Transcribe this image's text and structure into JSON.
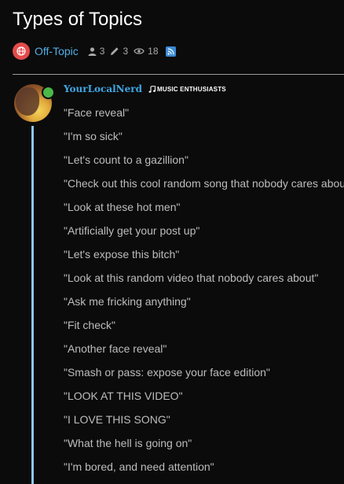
{
  "topic": {
    "title": "Types of Topics",
    "category": "Off-Topic",
    "stats": {
      "users": "3",
      "edits": "3",
      "views": "18"
    }
  },
  "post": {
    "username": "YourLocalNerd",
    "flair": "MUSIC ENTHUSIASTS",
    "items": [
      "\"Face reveal\"",
      "\"I'm so sick\"",
      "\"Let's count to a gazillion\"",
      "\"Check out this cool random song that nobody cares about\"",
      "\"Look at these hot men\"",
      "\"Artificially get your post up\"",
      "\"Let's expose this bitch\"",
      "\"Look at this random video that nobody cares about\"",
      "\"Ask me fricking anything\"",
      "\"Fit check\"",
      "\"Another face reveal\"",
      "\"Smash or pass: expose your face edition\"",
      "\"LOOK AT THIS VIDEO\"",
      "\"I LOVE THIS SONG\"",
      "\"What the hell is going on\"",
      "\"I'm bored, and need attention\""
    ]
  },
  "colors": {
    "accent": "#52aee6",
    "category_badge": "#e44b4b",
    "online": "#4bb848",
    "thread_line": "#8fc9ef"
  }
}
